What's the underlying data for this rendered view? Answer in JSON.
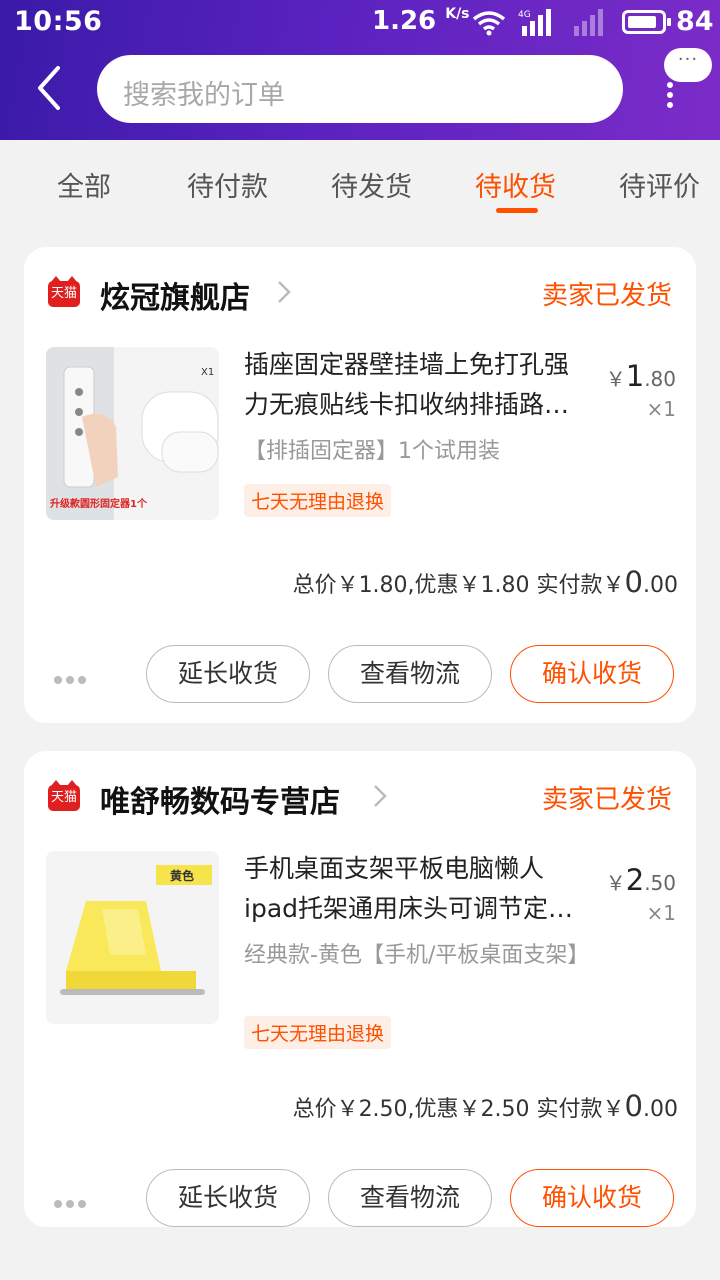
{
  "status_bar": {
    "time": "10:56",
    "speed": "1.26",
    "speed_unit": "K/s",
    "network": "4G",
    "battery": "84"
  },
  "search": {
    "placeholder": "搜索我的订单",
    "more_label": "···"
  },
  "tabs": [
    {
      "label": "全部",
      "active": false
    },
    {
      "label": "待付款",
      "active": false
    },
    {
      "label": "待发货",
      "active": false
    },
    {
      "label": "待收货",
      "active": true
    },
    {
      "label": "待评价",
      "active": false
    }
  ],
  "orders": [
    {
      "shop_badge": "天猫",
      "shop": "炫冠旗舰店",
      "status": "卖家已发货",
      "title_line1": "插座固定器壁挂墙上免打孔强",
      "title_line2": "力无痕贴线卡扣收纳排插路…",
      "sku": "【排插固定器】1个试用装",
      "tag": "七天无理由退换",
      "price_symbol": "￥",
      "price_int": "1",
      "price_dec": ".80",
      "qty": "×1",
      "total_text": "总价￥1.80,优惠￥1.80 实付款",
      "pay_int": "0",
      "pay_dec": ".00",
      "image_label": "升级款圆形固定器1个",
      "image_qty": "X1",
      "buttons": [
        "延长收货",
        "查看物流",
        "确认收货"
      ]
    },
    {
      "shop_badge": "天猫",
      "shop": "唯舒畅数码专营店",
      "status": "卖家已发货",
      "title_line1": "手机桌面支架平板电脑懒人",
      "title_line2": "ipad托架通用床头可调节定…",
      "sku": "经典款-黄色【手机/平板桌面支架】",
      "tag": "七天无理由退换",
      "price_symbol": "￥",
      "price_int": "2",
      "price_dec": ".50",
      "qty": "×1",
      "total_text": "总价￥2.50,优惠￥2.50 实付款",
      "pay_int": "0",
      "pay_dec": ".00",
      "image_label": "黄色",
      "buttons": [
        "延长收货",
        "查看物流",
        "确认收货"
      ]
    }
  ],
  "colors": {
    "accent": "#ff5000",
    "header_start": "#3a1aa8",
    "header_end": "#7c2cc8",
    "badge": "#e02020"
  }
}
